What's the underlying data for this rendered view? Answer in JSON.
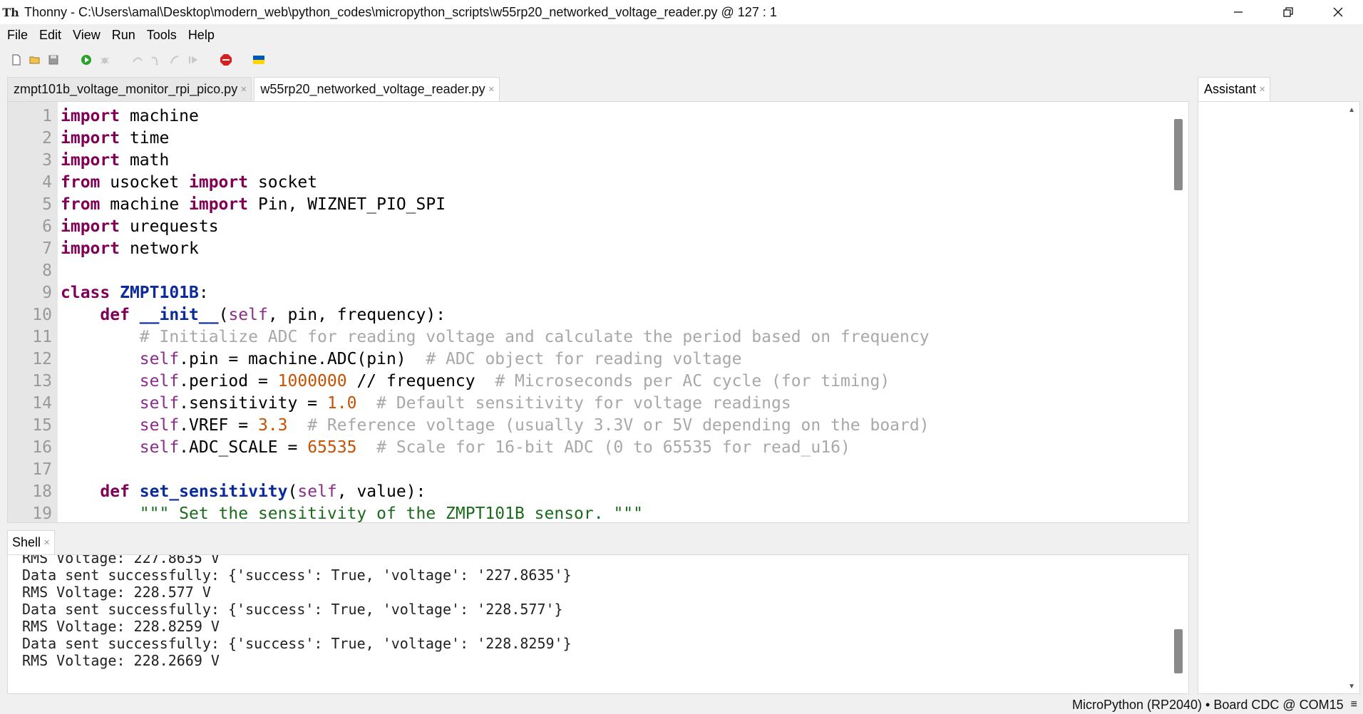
{
  "window": {
    "app_name": "Thonny",
    "title": "Thonny  -  C:\\Users\\amal\\Desktop\\modern_web\\python_codes\\micropython_scripts\\w55rp20_networked_voltage_reader.py  @  127 : 1"
  },
  "menu": [
    "File",
    "Edit",
    "View",
    "Run",
    "Tools",
    "Help"
  ],
  "toolbar": {
    "icons": [
      "new-file-icon",
      "open-file-icon",
      "save-icon",
      "run-icon",
      "debug-icon",
      "step-over-icon",
      "step-into-icon",
      "step-out-icon",
      "resume-icon",
      "stop-icon",
      "ukraine-flag-icon"
    ],
    "colors": {
      "run": "#2aa12a",
      "stop": "#d81e1e",
      "flag_blue": "#0057b7",
      "flag_yellow": "#ffd700"
    }
  },
  "editor": {
    "tabs": [
      {
        "label": "zmpt101b_voltage_monitor_rpi_pico.py",
        "active": false
      },
      {
        "label": "w55rp20_networked_voltage_reader.py",
        "active": true
      }
    ],
    "line_numbers": [
      "1",
      "2",
      "3",
      "4",
      "5",
      "6",
      "7",
      "8",
      "9",
      "10",
      "11",
      "12",
      "13",
      "14",
      "15",
      "16",
      "17",
      "18",
      "19"
    ],
    "tokens": {
      "l1": [
        "import",
        " machine"
      ],
      "l2": [
        "import",
        " time"
      ],
      "l3": [
        "import",
        " math"
      ],
      "l4": [
        "from",
        " usocket ",
        "import",
        " socket"
      ],
      "l5": [
        "from",
        " machine ",
        "import",
        " Pin, WIZNET_PIO_SPI"
      ],
      "l6": [
        "import",
        " urequests"
      ],
      "l7": [
        "import",
        " network"
      ],
      "l8": [],
      "l9": [
        "class",
        " ",
        "ZMPT101B",
        ":"
      ],
      "l10": [
        "    ",
        "def",
        " ",
        "__init__",
        "(",
        "self",
        ", pin, frequency):"
      ],
      "l11": [
        "        ",
        "# Initialize ADC for reading voltage and calculate the period based on frequency"
      ],
      "l12": [
        "        ",
        "self",
        ".pin = machine.ADC(pin)  ",
        "# ADC object for reading voltage"
      ],
      "l13": [
        "        ",
        "self",
        ".period = ",
        "1000000",
        " // frequency  ",
        "# Microseconds per AC cycle (for timing)"
      ],
      "l14": [
        "        ",
        "self",
        ".sensitivity = ",
        "1.0",
        "  ",
        "# Default sensitivity for voltage readings"
      ],
      "l15": [
        "        ",
        "self",
        ".VREF = ",
        "3.3",
        "  ",
        "# Reference voltage (usually 3.3V or 5V depending on the board)"
      ],
      "l16": [
        "        ",
        "self",
        ".ADC_SCALE = ",
        "65535",
        "  ",
        "# Scale for 16-bit ADC (0 to 65535 for read_u16)"
      ],
      "l17": [],
      "l18": [
        "    ",
        "def",
        " ",
        "set_sensitivity",
        "(",
        "self",
        ", value):"
      ],
      "l19": [
        "        ",
        "\"\"\" Set the sensitivity of the ZMPT101B sensor. \"\"\""
      ]
    }
  },
  "shell": {
    "tab_label": "Shell",
    "lines": [
      "RMS Voltage: 227.8635 V",
      "Data sent successfully: {'success': True, 'voltage': '227.8635'}",
      "RMS Voltage: 228.577 V",
      "Data sent successfully: {'success': True, 'voltage': '228.577'}",
      "RMS Voltage: 228.8259 V",
      "Data sent successfully: {'success': True, 'voltage': '228.8259'}",
      "RMS Voltage: 228.2669 V"
    ]
  },
  "assistant": {
    "tab_label": "Assistant"
  },
  "status": {
    "interpreter": "MicroPython (RP2040)  •  Board CDC @ COM15"
  }
}
